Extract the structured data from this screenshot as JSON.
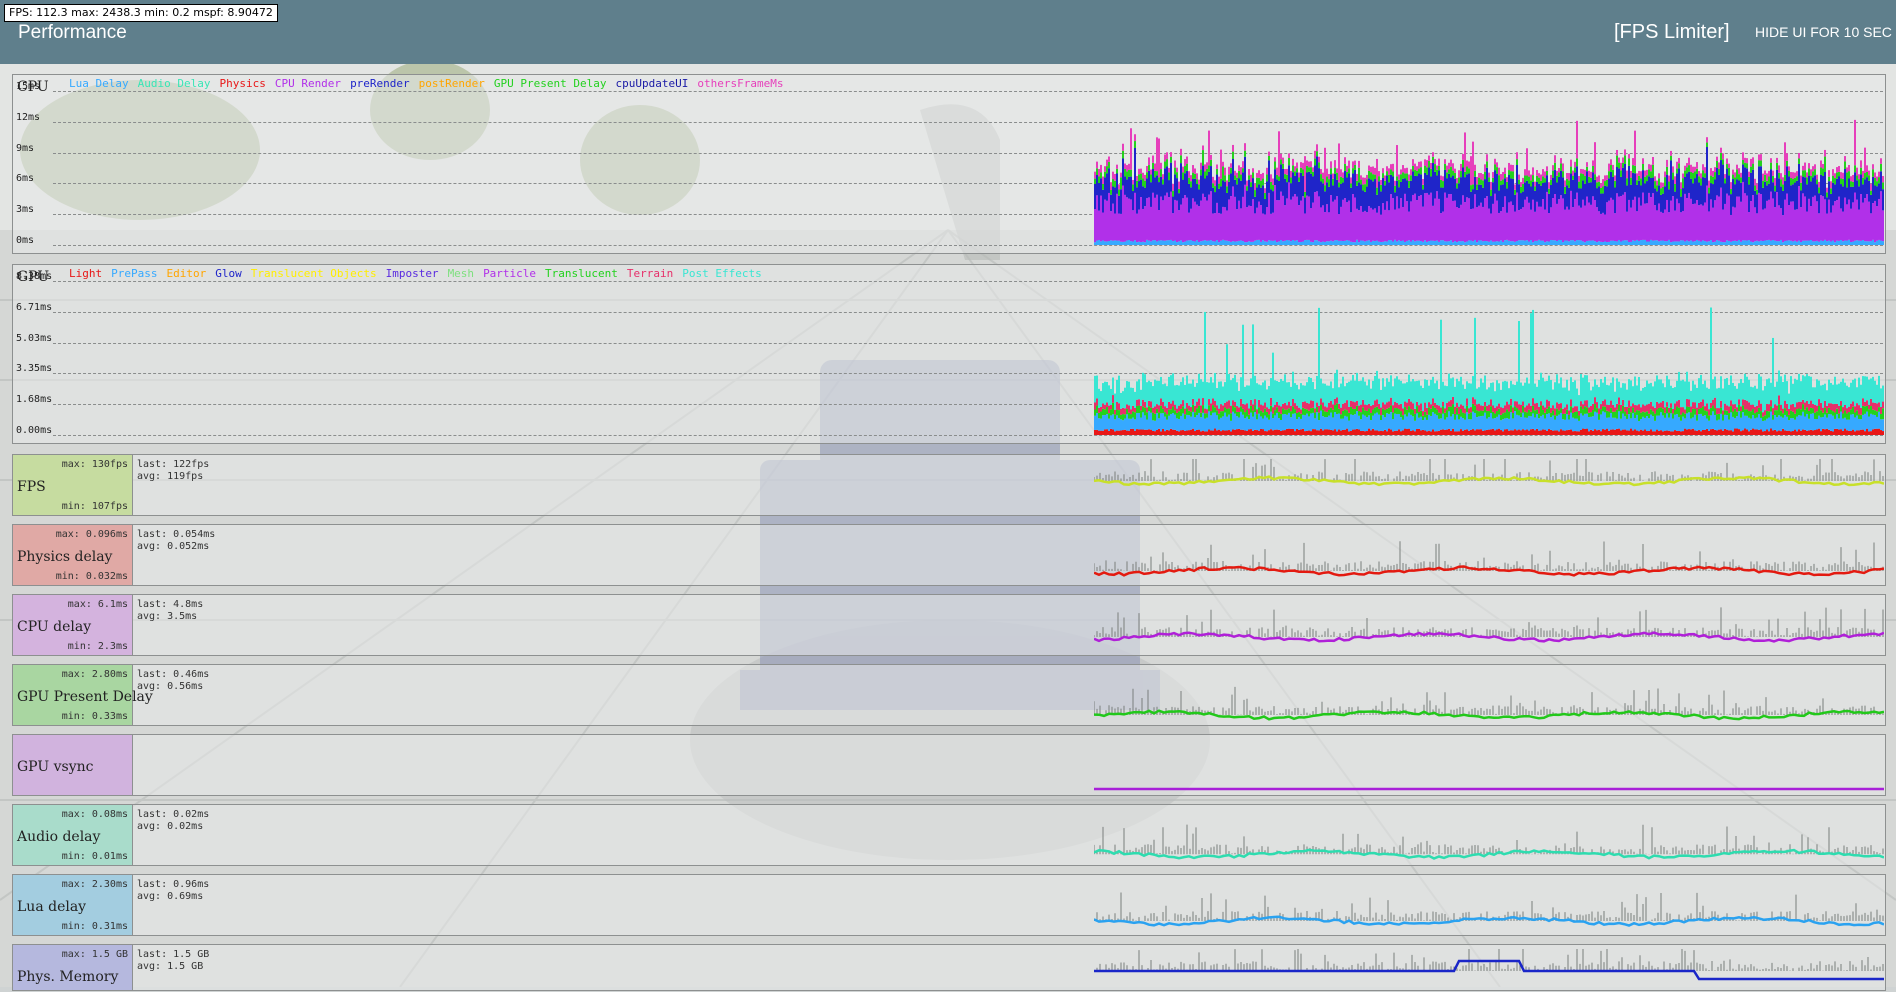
{
  "header": {
    "fps_counter": "FPS:  112.3  max:  2438.3  min:  0.2  mspf: 8.90472",
    "title": "Performance",
    "fps_limiter": "[FPS Limiter]",
    "hide_ui": "HIDE UI FOR 10 SEC"
  },
  "scene_colors": {
    "sky": "#e4e6e4",
    "ground": "#d6d8d6",
    "truck": "#8a93b5",
    "trees": "#8b9c6a"
  },
  "cpu": {
    "label": "CPU",
    "legend": [
      {
        "name": "Lua Delay",
        "color": "#36a9ff"
      },
      {
        "name": "Audio Delay",
        "color": "#39e6b6"
      },
      {
        "name": "Physics",
        "color": "#e81717"
      },
      {
        "name": "CPU Render",
        "color": "#b130e9"
      },
      {
        "name": "preRender",
        "color": "#1f25c9"
      },
      {
        "name": "postRender",
        "color": "#ffa500"
      },
      {
        "name": "GPU Present Delay",
        "color": "#23d11e"
      },
      {
        "name": "cpuUpdateUI",
        "color": "#1a1aa6"
      },
      {
        "name": "othersFrameMs",
        "color": "#e63fbb"
      }
    ],
    "axis": [
      "15ms",
      "12ms",
      "9ms",
      "6ms",
      "3ms",
      "0ms"
    ]
  },
  "gpu": {
    "label": "GPU",
    "legend": [
      {
        "name": "Light",
        "color": "#e81717"
      },
      {
        "name": "PrePass",
        "color": "#36a9ff"
      },
      {
        "name": "Editor",
        "color": "#ffa500"
      },
      {
        "name": "Glow",
        "color": "#1f25c9"
      },
      {
        "name": "Translucent Objects",
        "color": "#ffee00"
      },
      {
        "name": "Imposter",
        "color": "#5a2be0"
      },
      {
        "name": "Mesh",
        "color": "#7ee07e"
      },
      {
        "name": "Particle",
        "color": "#b130e9"
      },
      {
        "name": "Translucent",
        "color": "#23d11e"
      },
      {
        "name": "Terrain",
        "color": "#e6306a"
      },
      {
        "name": "Post Effects",
        "color": "#39e6d3"
      }
    ],
    "axis": [
      "8.38ms",
      "6.71ms",
      "5.03ms",
      "3.35ms",
      "1.68ms",
      "0.00ms"
    ]
  },
  "metrics": [
    {
      "id": "fps",
      "name": "FPS",
      "max": "max: 130fps",
      "min": "min: 107fps",
      "last": "last: 122fps",
      "avg": "avg: 119fps",
      "bg": "#c6dca0",
      "line": "#c8e02a",
      "level": 0.7
    },
    {
      "id": "physics",
      "name": "Physics delay",
      "max": "max: 0.096ms",
      "min": "min: 0.032ms",
      "last": "last: 0.054ms",
      "avg": "avg: 0.052ms",
      "bg": "#e0a9a5",
      "line": "#e31a10",
      "level": 0.2
    },
    {
      "id": "cpu",
      "name": "CPU delay",
      "max": "max: 6.1ms",
      "min": "min: 2.3ms",
      "last": "last: 4.8ms",
      "avg": "avg: 3.5ms",
      "bg": "#d4b3de",
      "line": "#b020d8",
      "level": 0.3
    },
    {
      "id": "gpupresent",
      "name": "GPU Present Delay",
      "max": "max: 2.80ms",
      "min": "min: 0.33ms",
      "last": "last: 0.46ms",
      "avg": "avg: 0.56ms",
      "bg": "#a9d6a1",
      "line": "#22c81a",
      "level": 0.1
    },
    {
      "id": "vsync",
      "name": "GPU vsync",
      "max": "",
      "min": "",
      "last": "",
      "avg": "",
      "bg": "#d1b3de",
      "line": "#a820d8",
      "level": 0.0
    },
    {
      "id": "audio",
      "name": "Audio delay",
      "max": "max: 0.08ms",
      "min": "min: 0.01ms",
      "last": "last: 0.02ms",
      "avg": "avg: 0.02ms",
      "bg": "#a9dccb",
      "line": "#2edcaf",
      "level": 0.12
    },
    {
      "id": "lua",
      "name": "Lua delay",
      "max": "max: 2.30ms",
      "min": "min: 0.31ms",
      "last": "last: 0.96ms",
      "avg": "avg: 0.69ms",
      "bg": "#a3cde0",
      "line": "#2aa2f0",
      "level": 0.2
    },
    {
      "id": "physmem",
      "name": "Phys. Memory",
      "max": "max: 1.5 GB",
      "min": "",
      "last": "last: 1.5 GB",
      "avg": "avg: 1.5 GB",
      "bg": "#b5b8de",
      "line": "#1a26c8",
      "level": 0.7
    }
  ]
}
